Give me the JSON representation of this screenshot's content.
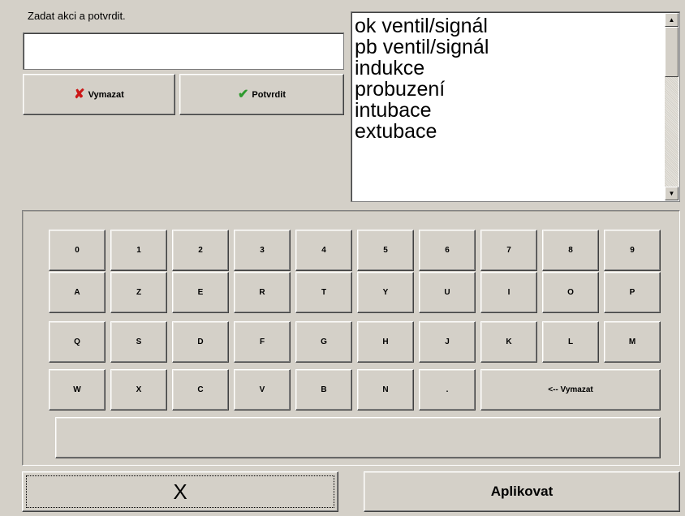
{
  "prompt_label": "Zadat akci a potvrdit.",
  "input": {
    "value": "",
    "placeholder": ""
  },
  "clear_button": {
    "label": "Vymazat",
    "icon": "x-icon",
    "icon_color": "#cc1818"
  },
  "confirm_button": {
    "label": "Potvrdit",
    "icon": "check-icon",
    "icon_color": "#2e9a2e"
  },
  "action_list": {
    "items": [
      "ok ventil/signál",
      "pb ventil/signál",
      "indukce",
      "probuzení",
      "intubace",
      "extubace"
    ]
  },
  "keyboard": {
    "rows": [
      [
        "0",
        "1",
        "2",
        "3",
        "4",
        "5",
        "6",
        "7",
        "8",
        "9"
      ],
      [
        "A",
        "Z",
        "E",
        "R",
        "T",
        "Y",
        "U",
        "I",
        "O",
        "P"
      ],
      [
        "Q",
        "S",
        "D",
        "F",
        "G",
        "H",
        "J",
        "K",
        "L",
        "M"
      ],
      [
        "W",
        "X",
        "C",
        "V",
        "B",
        "N",
        "."
      ]
    ],
    "backspace_label": "<-- Vymazat",
    "space_label": ""
  },
  "close_button": {
    "label": "X"
  },
  "apply_button": {
    "label": "Aplikovat"
  },
  "colors": {
    "background": "#d4d0c8",
    "clear_icon": "#cc1818",
    "confirm_icon": "#2e9a2e"
  }
}
